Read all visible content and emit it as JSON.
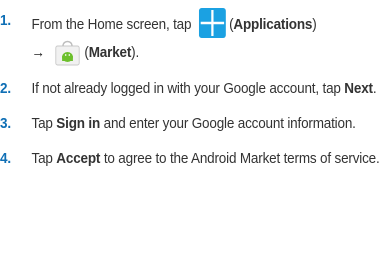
{
  "steps": [
    {
      "num": "1.",
      "parts": {
        "a": "From the Home screen, tap",
        "b": "(",
        "c": "Applications",
        "d": ")",
        "arrow": "→",
        "e": "(",
        "f": "Market",
        "g": ")."
      },
      "icons": [
        "applications-icon",
        "market-icon"
      ]
    },
    {
      "num": "2.",
      "parts": {
        "a": "If not already logged in with your Google account, tap ",
        "b": "Next",
        "c": "."
      }
    },
    {
      "num": "3.",
      "parts": {
        "a": "Tap ",
        "b": "Sign in",
        "c": " and enter your Google account information."
      }
    },
    {
      "num": "4.",
      "parts": {
        "a": "Tap ",
        "b": "Accept",
        "c": " to agree to the Android Market terms of service."
      }
    }
  ],
  "colors": {
    "step_number": "#0f6fb5",
    "apps_icon_blue": "#1ba1e2",
    "market_green": "#6cbf2c"
  }
}
